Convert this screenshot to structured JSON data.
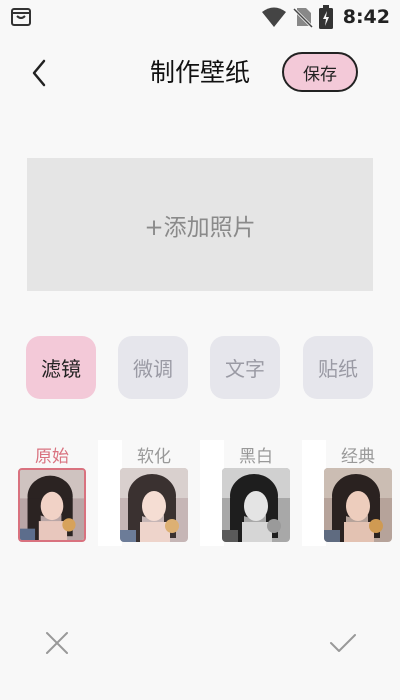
{
  "status_bar": {
    "time": "8:42",
    "icons": [
      "app-bag-icon",
      "wifi-icon",
      "no-sim-icon",
      "battery-charging-icon"
    ]
  },
  "header": {
    "back_icon": "chevron-left-icon",
    "title": "制作壁纸",
    "save_label": "保存"
  },
  "canvas": {
    "add_photo_label": "+添加照片"
  },
  "tabs": [
    {
      "label": "滤镜",
      "active": true
    },
    {
      "label": "微调",
      "active": false
    },
    {
      "label": "文字",
      "active": false
    },
    {
      "label": "贴纸",
      "active": false
    }
  ],
  "filters": [
    {
      "label": "原始",
      "selected": true
    },
    {
      "label": "软化",
      "selected": false
    },
    {
      "label": "黑白",
      "selected": false
    },
    {
      "label": "经典",
      "selected": false
    }
  ],
  "bottom_bar": {
    "cancel_icon": "close-icon",
    "confirm_icon": "check-icon"
  },
  "colors": {
    "accent_pink": "#f3c9d8",
    "selected_red": "#d9727f",
    "tab_inactive": "#e6e6ec",
    "placeholder_bg": "#e5e5e5"
  }
}
